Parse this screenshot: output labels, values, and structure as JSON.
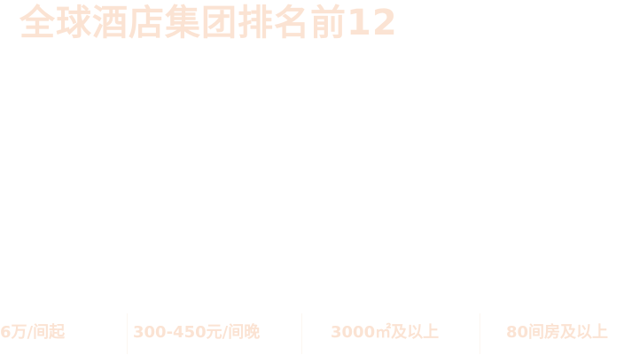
{
  "header": {
    "title": "全球酒店集团排名前12"
  },
  "stats": {
    "items": [
      {
        "text": "6万/间起"
      },
      {
        "text": "300-450元/间晚"
      },
      {
        "text": "3000㎡及以上"
      },
      {
        "text": "80间房及以上"
      }
    ]
  },
  "colors": {
    "text": "#fbe3d3",
    "background": "#ffffff",
    "divider": "#fcf6f1"
  }
}
